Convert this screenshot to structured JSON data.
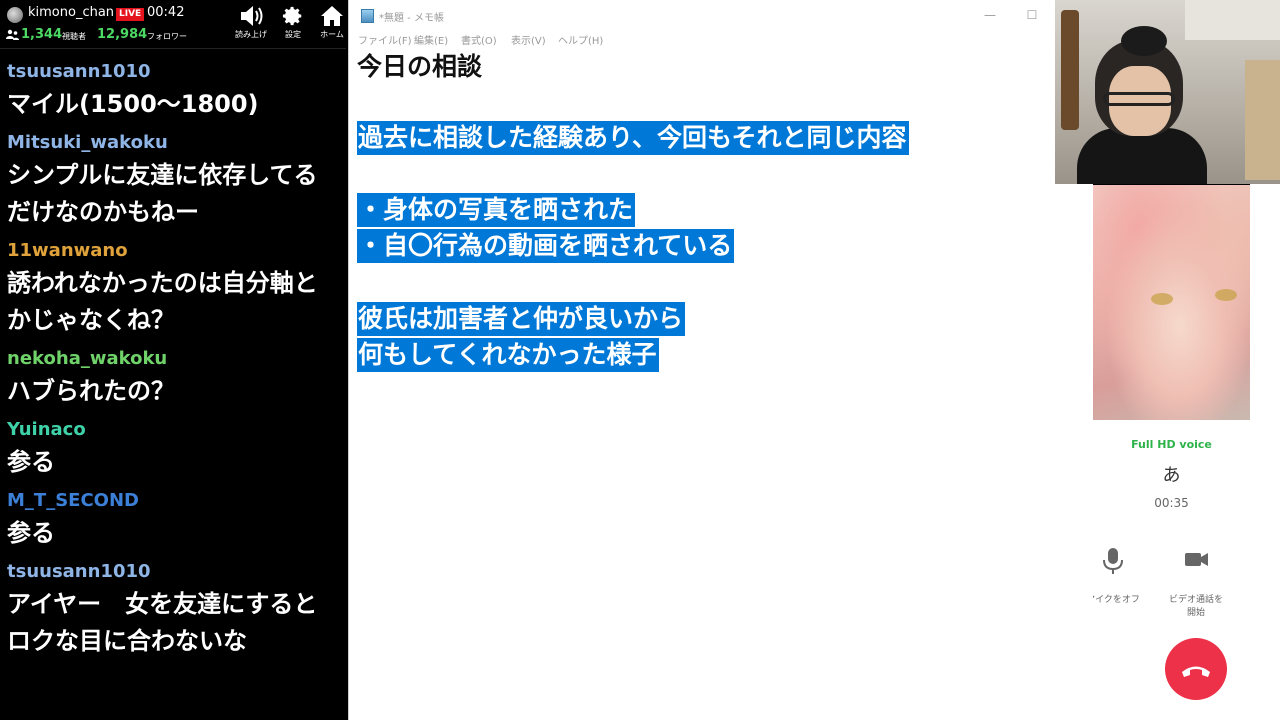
{
  "stream": {
    "channel_name": "kimono_chan",
    "live_label": "LIVE",
    "elapsed": "00:42",
    "viewer_count": "1,344",
    "viewer_label": "視聴者",
    "follower_count": "12,984",
    "follower_label": "フォロワー",
    "buttons": {
      "read_aloud": "読み上げ",
      "settings": "設定",
      "home": "ホーム"
    }
  },
  "comments": [
    {
      "user": "tsuusann1010",
      "color": "#8fb4e6",
      "text": "マイル(1500〜1800)"
    },
    {
      "user": "Mitsuki_wakoku",
      "color": "#8fb4e6",
      "text": "シンプルに友達に依存してるだけなのかもねー"
    },
    {
      "user": "11wanwano",
      "color": "#e0a23a",
      "text": "誘われなかったのは自分軸とかじゃなくね？"
    },
    {
      "user": "nekoha_wakoku",
      "color": "#6fd36a",
      "text": "ハブられたの？"
    },
    {
      "user": "Yuinaco",
      "color": "#3fd1a8",
      "text": "参る"
    },
    {
      "user": "M_T_SECOND",
      "color": "#3b7fd6",
      "text": "参る"
    },
    {
      "user": "tsuusann1010",
      "color": "#8fb4e6",
      "text": "アイヤー　女を友達にするとロクな目に合わないな"
    }
  ],
  "notepad": {
    "title": "*無題 - メモ帳",
    "menu": [
      "ファイル(F)",
      "編集(E)",
      "書式(O)",
      "表示(V)",
      "ヘルプ(H)"
    ],
    "heading": "今日の相談",
    "selected_lines": [
      "過去に相談した経験あり、今回もそれと同じ内容",
      "・身体の写真を晒された",
      "・自〇行為の動画を晒されている",
      "彼氏は加害者と仲が良いから",
      "何もしてくれなかった様子"
    ],
    "selection_color": "#0078d7"
  },
  "call": {
    "status": "Full HD voice",
    "caller": "あ",
    "timer": "00:35",
    "mute_label": "マイクをオフ",
    "video_label_1": "ビデオ通話を",
    "video_label_2": "開始",
    "end_color": "#ec3148"
  }
}
